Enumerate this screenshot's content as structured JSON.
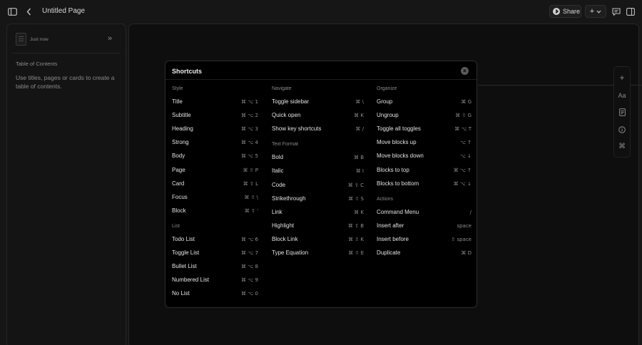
{
  "header": {
    "page_title": "Untitled Page",
    "share_label": "Share",
    "add_label": "+"
  },
  "sidebar": {
    "timestamp": "Just now",
    "toc_title": "Table of Contents",
    "toc_empty": "Use titles, pages or cards to create a table of contents."
  },
  "toolbar": {
    "add_icon": "plus-icon",
    "text_style_label": "Aa",
    "doc_icon": "document-icon",
    "info_icon": "info-icon",
    "cmd_label": "⌘"
  },
  "modal": {
    "title": "Shortcuts",
    "columns": [
      {
        "sections": [
          {
            "title": "Style",
            "items": [
              {
                "label": "Title",
                "keys": "⌘ ⌥ 1"
              },
              {
                "label": "Subtitle",
                "keys": "⌘ ⌥ 2"
              },
              {
                "label": "Heading",
                "keys": "⌘ ⌥ 3"
              },
              {
                "label": "Strong",
                "keys": "⌘ ⌥ 4"
              },
              {
                "label": "Body",
                "keys": "⌘ ⌥ 5"
              },
              {
                "label": "Page",
                "keys": "⌘ ⇧ P"
              },
              {
                "label": "Card",
                "keys": "⌘ ⇧ L"
              },
              {
                "label": "Focus",
                "keys": "⌘ ⇧ \\"
              },
              {
                "label": "Block",
                "keys": "⌘ ⇧ '"
              }
            ]
          },
          {
            "title": "List",
            "items": [
              {
                "label": "Todo List",
                "keys": "⌘ ⌥ 6"
              },
              {
                "label": "Toggle List",
                "keys": "⌘ ⌥ 7"
              },
              {
                "label": "Bullet List",
                "keys": "⌘ ⌥ 8"
              },
              {
                "label": "Numbered List",
                "keys": "⌘ ⌥ 9"
              },
              {
                "label": "No List",
                "keys": "⌘ ⌥ 0"
              }
            ]
          }
        ]
      },
      {
        "sections": [
          {
            "title": "Navigate",
            "items": [
              {
                "label": "Toggle sidebar",
                "keys": "⌘ \\"
              },
              {
                "label": "Quick open",
                "keys": "⌘ K"
              },
              {
                "label": "Show key shortcuts",
                "keys": "⌘ /"
              }
            ]
          },
          {
            "title": "Text Format",
            "items": [
              {
                "label": "Bold",
                "keys": "⌘ B"
              },
              {
                "label": "Italic",
                "keys": "⌘ I"
              },
              {
                "label": "Code",
                "keys": "⌘ ⇧ C"
              },
              {
                "label": "Strikethrough",
                "keys": "⌘ ⇧ S"
              },
              {
                "label": "Link",
                "keys": "⌘ K"
              },
              {
                "label": "Highlight",
                "keys": "⌘ ⇧ B"
              },
              {
                "label": "Block Link",
                "keys": "⌘ ⇧ K"
              },
              {
                "label": "Type Equation",
                "keys": "⌘ ⇧ E"
              }
            ]
          }
        ]
      },
      {
        "sections": [
          {
            "title": "Organize",
            "items": [
              {
                "label": "Group",
                "keys": "⌘ G"
              },
              {
                "label": "Ungroup",
                "keys": "⌘ ⇧ G"
              },
              {
                "label": "Toggle all toggles",
                "keys": "⌘ ⌥ T"
              },
              {
                "label": "Move blocks up",
                "keys": "⌥ ↑"
              },
              {
                "label": "Move blocks down",
                "keys": "⌥ ↓"
              },
              {
                "label": "Blocks to top",
                "keys": "⌘ ⌥ ↑"
              },
              {
                "label": "Blocks to bottom",
                "keys": "⌘ ⌥ ↓"
              }
            ]
          },
          {
            "title": "Actions",
            "items": [
              {
                "label": "Command Menu",
                "keys": "/"
              },
              {
                "label": "Insert after",
                "keys": "space"
              },
              {
                "label": "Insert before",
                "keys": "⇧ space"
              },
              {
                "label": "Duplicate",
                "keys": "⌘ D"
              }
            ]
          }
        ]
      }
    ]
  }
}
